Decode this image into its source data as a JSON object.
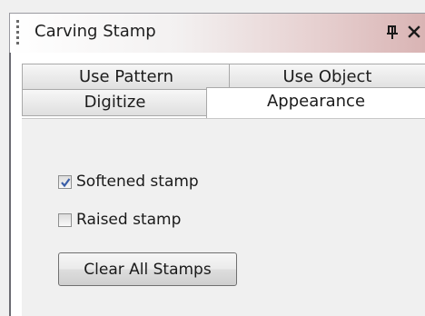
{
  "panel": {
    "title": "Carving Stamp",
    "controls": {
      "pin_icon": "pin-icon",
      "close_icon": "close-icon"
    }
  },
  "tabs": [
    {
      "label": "Use Pattern",
      "selected": false
    },
    {
      "label": "Use Object",
      "selected": false
    },
    {
      "label": "Digitize",
      "selected": false
    },
    {
      "label": "Appearance",
      "selected": true
    }
  ],
  "options": {
    "softened": {
      "label": "Softened stamp",
      "checked": true
    },
    "raised": {
      "label": "Raised stamp",
      "checked": false
    }
  },
  "actions": {
    "clear_all_label": "Clear All Stamps"
  },
  "colors": {
    "check_mark": "#3a5ea8"
  }
}
